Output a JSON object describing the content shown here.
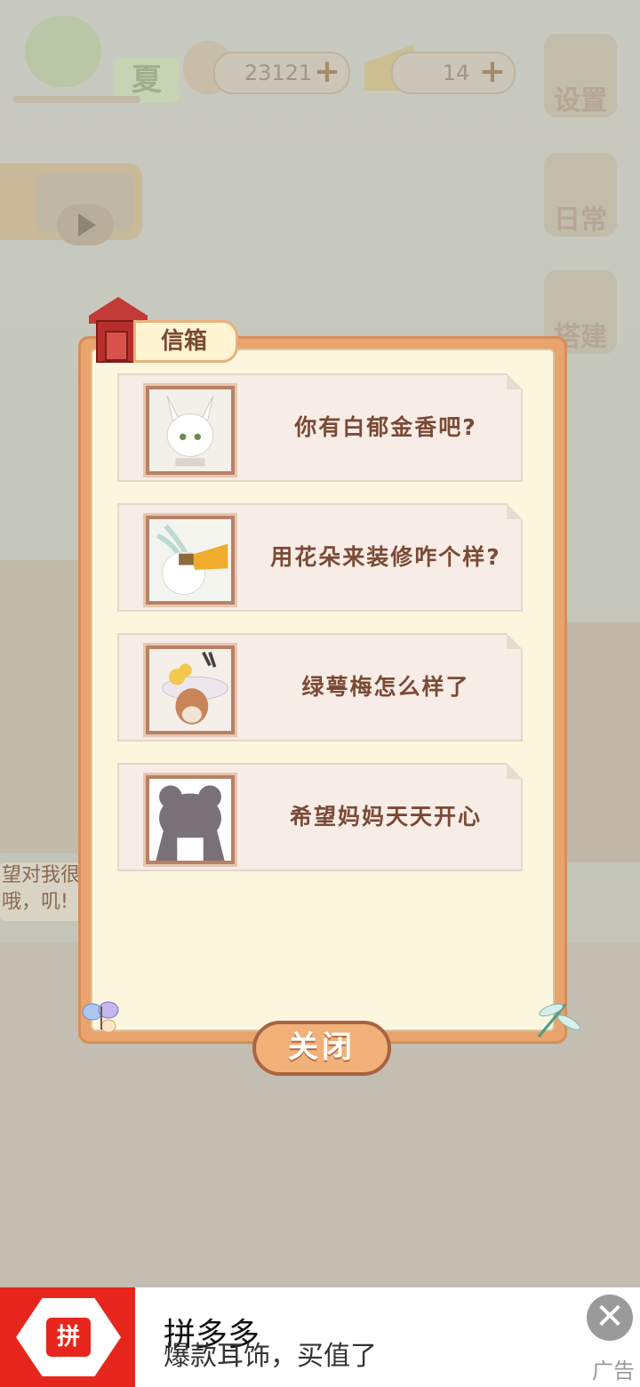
{
  "hud": {
    "season": "夏",
    "fish_count": "23121",
    "cheese_count": "14",
    "plus_icon": "+"
  },
  "side_menu": {
    "settings": "设置",
    "daily": "日常",
    "build": "搭建"
  },
  "background": {
    "speech_line1": "望对我很",
    "speech_line2": "哦，叽!"
  },
  "mailbox": {
    "title": "信箱",
    "letters": [
      {
        "text": "你有白郁金香吧?",
        "avatar": "white-fox-avatar"
      },
      {
        "text": "用花朵来装修咋个样?",
        "avatar": "white-bird-avatar"
      },
      {
        "text": "绿萼梅怎么样了",
        "avatar": "antelope-hat-avatar"
      },
      {
        "text": "希望妈妈天天开心",
        "avatar": "silhouette-avatar"
      }
    ],
    "close_label": "关闭"
  },
  "ad": {
    "brand_logo_text": "拼",
    "title": "拼多多",
    "subtitle": "爆款耳饰，买值了",
    "tag": "广告",
    "close_icon": "✕"
  },
  "colors": {
    "dialog_border": "#e9a36c",
    "dialog_bg": "#fdf6df",
    "letter_text": "#7b4a36",
    "ad_red": "#e6261c"
  }
}
